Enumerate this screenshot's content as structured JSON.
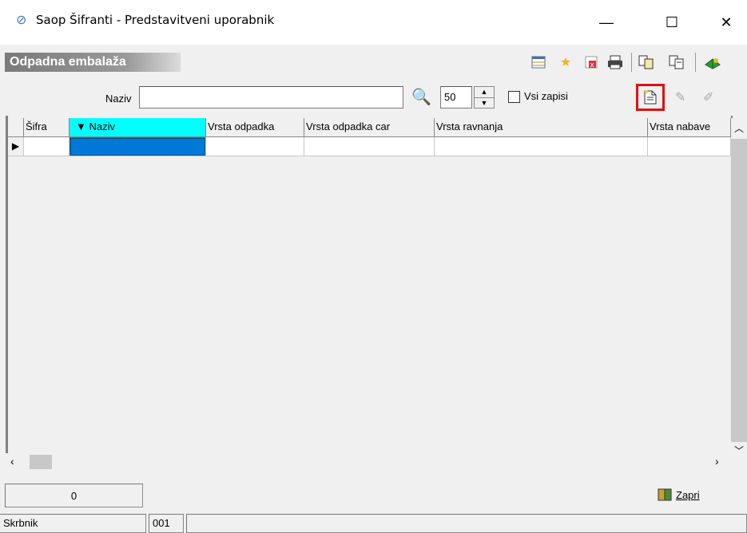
{
  "window": {
    "title": "Saop Šifranti - Predstavitveni uporabnik",
    "minimize": "—",
    "maximize": "☐",
    "close": "✕"
  },
  "header": {
    "title": "Odpadna embalaža"
  },
  "toolbar": {
    "icons": [
      "table-icon",
      "star-icon",
      "delete-icon",
      "print-icon",
      "copy-icon",
      "paste-icon",
      "book-icon"
    ]
  },
  "search": {
    "label": "Naziv",
    "value": "",
    "count_value": "50",
    "all_records_label": "Vsi zapisi",
    "all_records_checked": false
  },
  "grid": {
    "columns": [
      "Šifra",
      "▼ Naziv",
      "Vrsta odpadka",
      "Vrsta odpadka car",
      "Vrsta ravnanja",
      "Vrsta nabave"
    ],
    "rows": [
      [
        "",
        "",
        "",
        "",
        "",
        ""
      ]
    ]
  },
  "footer": {
    "count": "0",
    "close_label": "Zapri"
  },
  "statusbar": {
    "user_label": "Skrbnik",
    "code": "001",
    "info": ""
  },
  "colors": {
    "accent_header": "#00ffff",
    "selected_cell": "#0078d7",
    "highlight": "#e01010"
  }
}
